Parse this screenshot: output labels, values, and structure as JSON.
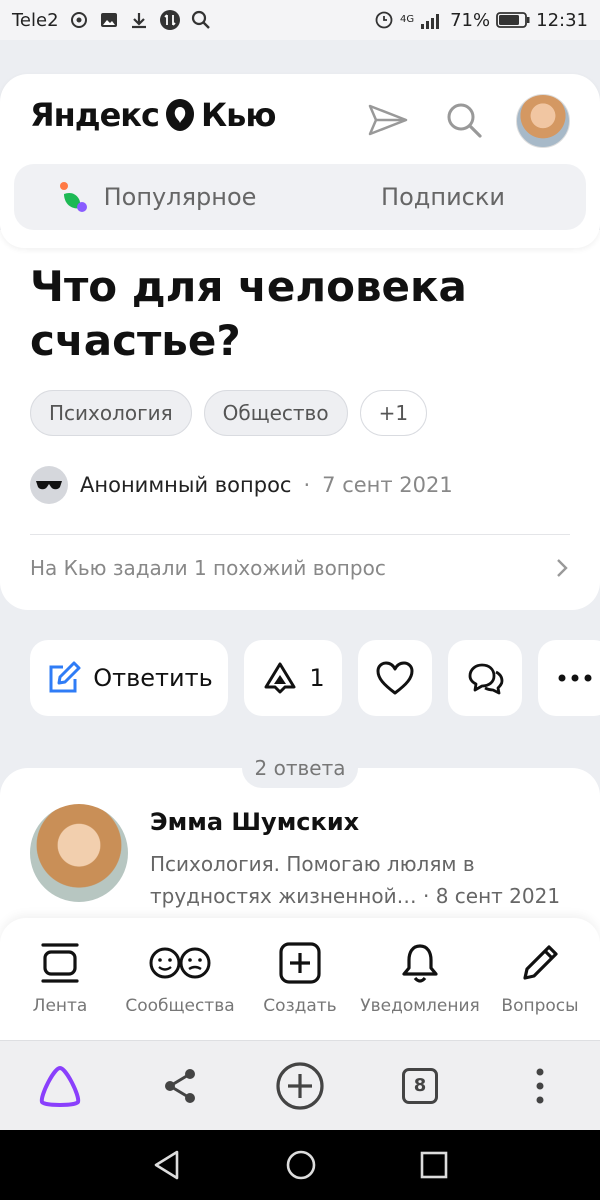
{
  "status_bar": {
    "carrier": "Tele2",
    "network": "4G",
    "battery": "71%",
    "time": "12:31"
  },
  "header": {
    "logo_left": "Яндекс",
    "logo_right": "Кью",
    "tabs": [
      {
        "label": "Популярное"
      },
      {
        "label": "Подписки"
      }
    ]
  },
  "question": {
    "title": "Что для человека счастье?",
    "tags": [
      "Психология",
      "Общество"
    ],
    "more_tags": "+1",
    "author": "Анонимный вопрос",
    "separator": "·",
    "date": "7 сент 2021",
    "similar": "На Кью задали 1 похожий вопрос"
  },
  "actions": {
    "answer_label": "Ответить",
    "upvotes": "1"
  },
  "answers": {
    "count_label": "2 ответа",
    "first": {
      "name": "Эмма Шумских",
      "description": "Психология. Помогаю люлям в трудностях жизненной…",
      "date": "8 сент 2021"
    }
  },
  "bottom_nav": [
    {
      "label": "Лента",
      "icon": "feed-icon"
    },
    {
      "label": "Сообщества",
      "icon": "communities-icon"
    },
    {
      "label": "Создать",
      "icon": "create-icon"
    },
    {
      "label": "Уведомления",
      "icon": "bell-icon"
    },
    {
      "label": "Вопросы",
      "icon": "pencil-icon"
    }
  ],
  "browser_bar": {
    "tabs_count": "8"
  },
  "colors": {
    "accent_blue": "#2f7cf6",
    "alice_purple": "#8a3ffc"
  }
}
